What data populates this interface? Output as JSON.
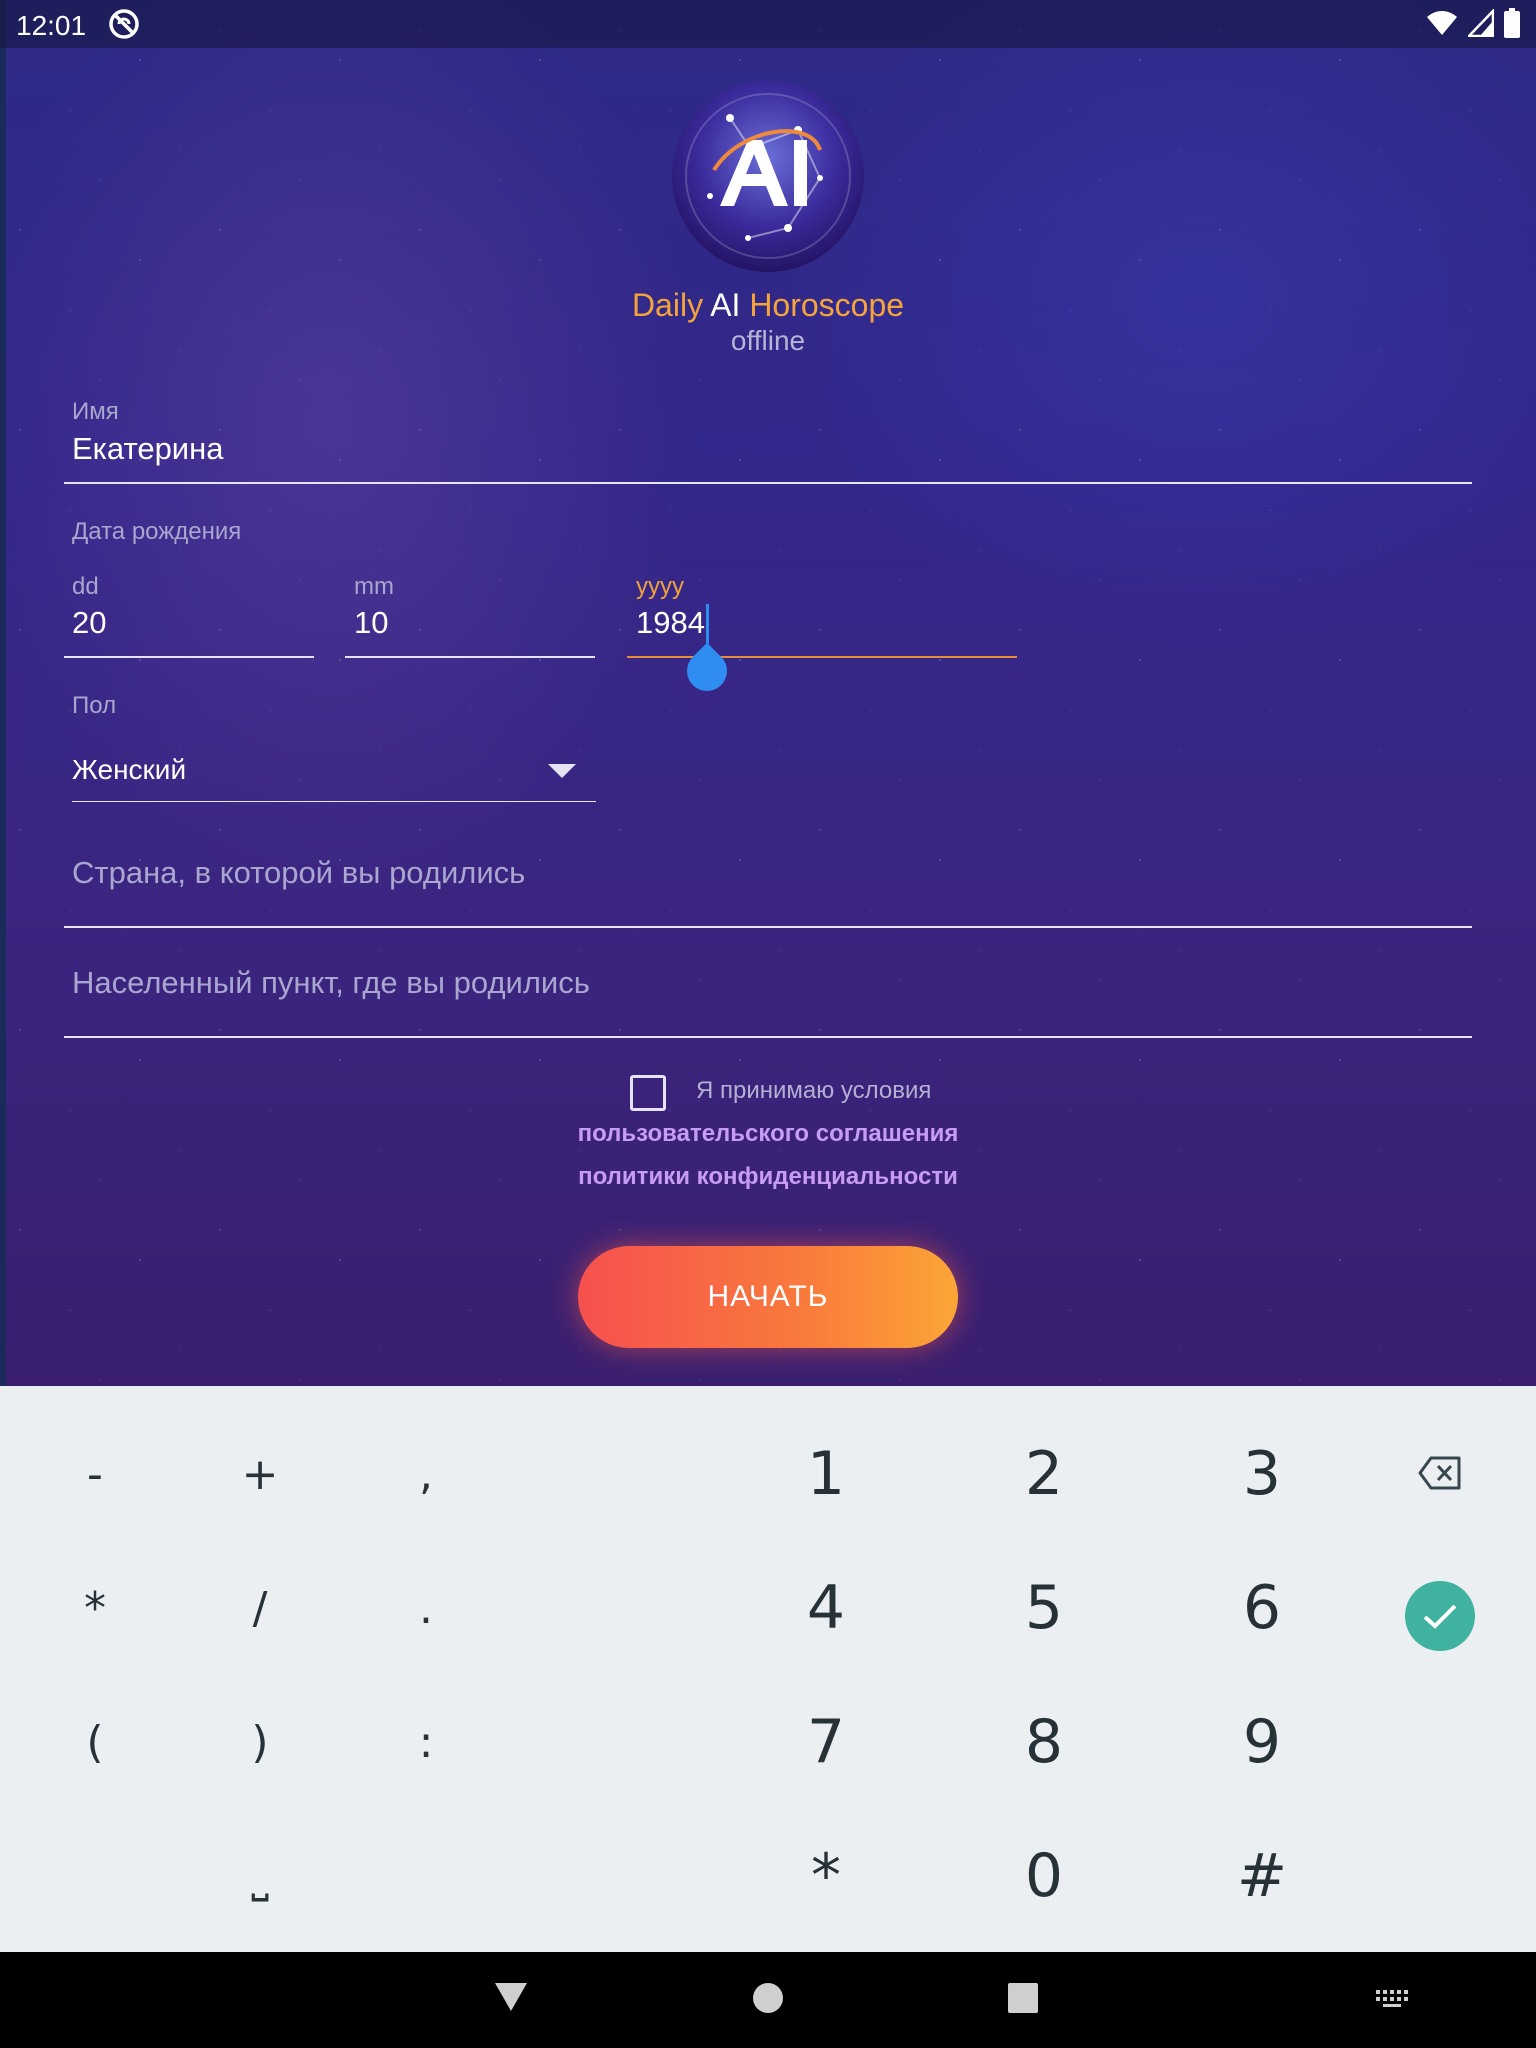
{
  "status_bar": {
    "time": "12:01"
  },
  "app": {
    "title_daily": "Daily",
    "title_ai": "AI",
    "title_horoscope": "Horoscope",
    "subtitle": "offline"
  },
  "form": {
    "name": {
      "label": "Имя",
      "value": "Екатерина"
    },
    "birth_date": {
      "label": "Дата рождения",
      "day": {
        "label": "dd",
        "value": "20"
      },
      "month": {
        "label": "mm",
        "value": "10"
      },
      "year": {
        "label": "yyyy",
        "value": "1984"
      }
    },
    "gender": {
      "label": "Пол",
      "selected": "Женский"
    },
    "country": {
      "placeholder": "Страна, в которой вы родились"
    },
    "city": {
      "placeholder": "Населенный пункт, где вы родились"
    },
    "terms": {
      "text": "Я принимаю условия",
      "user_agreement_link": "пользовательского соглашения",
      "privacy_policy_link": "политики конфиденциальности",
      "checked": false
    },
    "start_button": "НАЧАТЬ"
  },
  "keyboard": {
    "symbols": [
      [
        "-",
        "+",
        ","
      ],
      [
        "*",
        "/",
        "."
      ],
      [
        "(",
        ")",
        ":"
      ],
      [
        "",
        "⎵",
        ""
      ]
    ],
    "numbers": [
      [
        "1",
        "2",
        "3"
      ],
      [
        "4",
        "5",
        "6"
      ],
      [
        "7",
        "8",
        "9"
      ],
      [
        "*",
        "0",
        "#"
      ]
    ],
    "accent_color": "#3fb39f"
  },
  "colors": {
    "accent_orange": "#f5a43b",
    "link_purple": "#c69cf4",
    "cursor_blue": "#2f8cf0"
  }
}
